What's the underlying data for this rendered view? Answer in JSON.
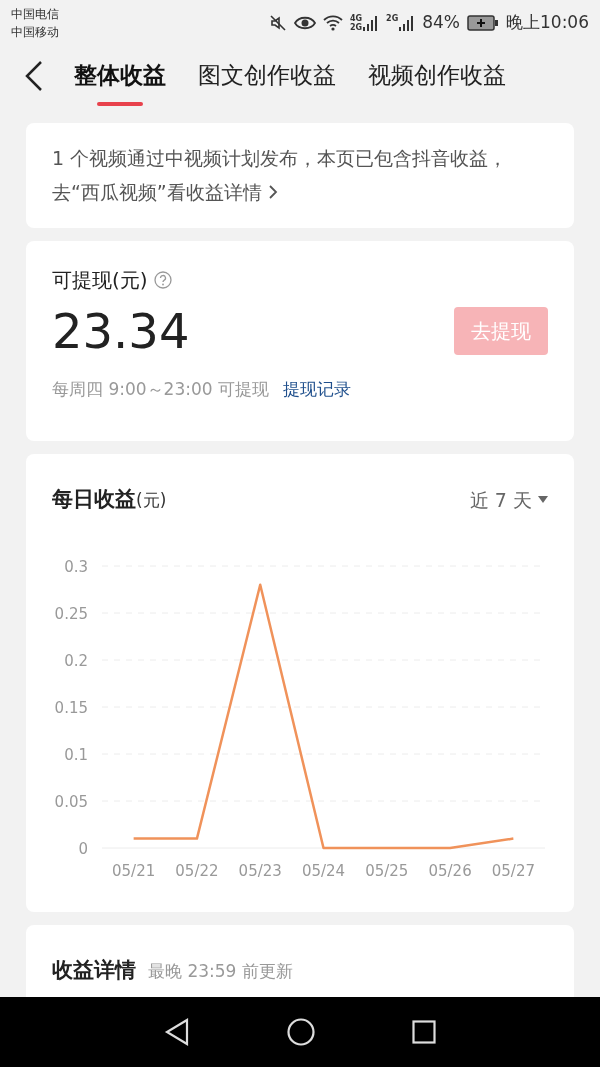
{
  "status_bar": {
    "carriers": [
      "中国电信",
      "中国移动"
    ],
    "network_labels": [
      "4G",
      "2G",
      "2G"
    ],
    "battery": "84%",
    "time": "晚上10:06"
  },
  "tabs": [
    {
      "label": "整体收益",
      "selected": true
    },
    {
      "label": "图文创作收益",
      "selected": false
    },
    {
      "label": "视频创作收益",
      "selected": false
    }
  ],
  "notice": {
    "text": "1 个视频通过中视频计划发布，本页已包含抖音收益，去“西瓜视频”看收益详情"
  },
  "withdraw": {
    "label": "可提现(元)",
    "amount": "23.34",
    "button": "去提现",
    "button_disabled": true,
    "schedule": "每周四 9:00～23:00 可提现",
    "history_link": "提现记录"
  },
  "daily": {
    "title": "每日收益",
    "unit": "(元)",
    "range": "近 7 天",
    "chart_data": {
      "type": "line",
      "categories": [
        "05/21",
        "05/22",
        "05/23",
        "05/24",
        "05/25",
        "05/26",
        "05/27"
      ],
      "grid": true,
      "series": [
        {
          "color": "#f0925a",
          "values": [
            0.01,
            0.01,
            0.28,
            0,
            0,
            0,
            0.01
          ]
        }
      ],
      "ylim": [
        0,
        0.3
      ],
      "yticks": [
        0,
        0.05,
        0.1,
        0.15,
        0.2,
        0.25,
        0.3
      ]
    }
  },
  "details": {
    "title": "收益详情",
    "subtitle": "最晚 23:59 前更新"
  }
}
